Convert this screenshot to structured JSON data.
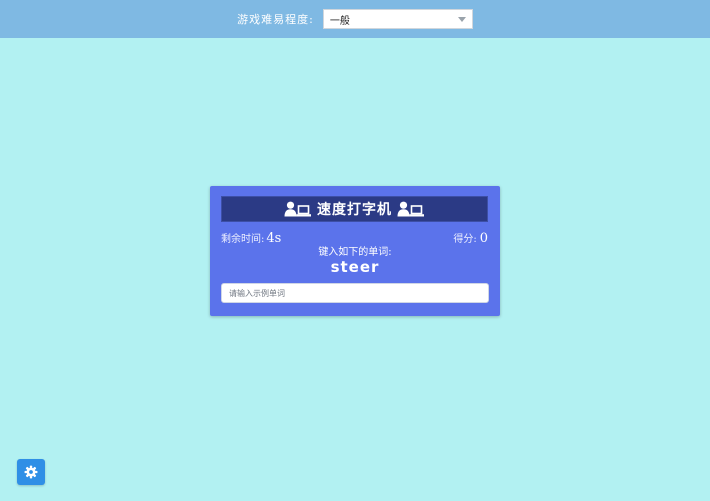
{
  "topbar": {
    "difficulty_label": "游戏难易程度:",
    "difficulty_selected": "一般"
  },
  "card": {
    "title": "速度打字机",
    "time_label": "剩余时间:",
    "time_value": "4s",
    "score_label": "得分:",
    "score_value": "0",
    "prompt": "键入如下的单词:",
    "word": "steer",
    "input_value": "",
    "input_placeholder": "请输入示例单词"
  },
  "icons": {
    "header_left": "user-laptop-icon",
    "header_right": "user-laptop-icon",
    "settings": "gear-icon"
  },
  "colors": {
    "background": "#b2f1f2",
    "topbar": "#7fb9e3",
    "card": "#5b73eb",
    "card_header": "#2b3a85",
    "settings_button": "#2f8fe6"
  }
}
